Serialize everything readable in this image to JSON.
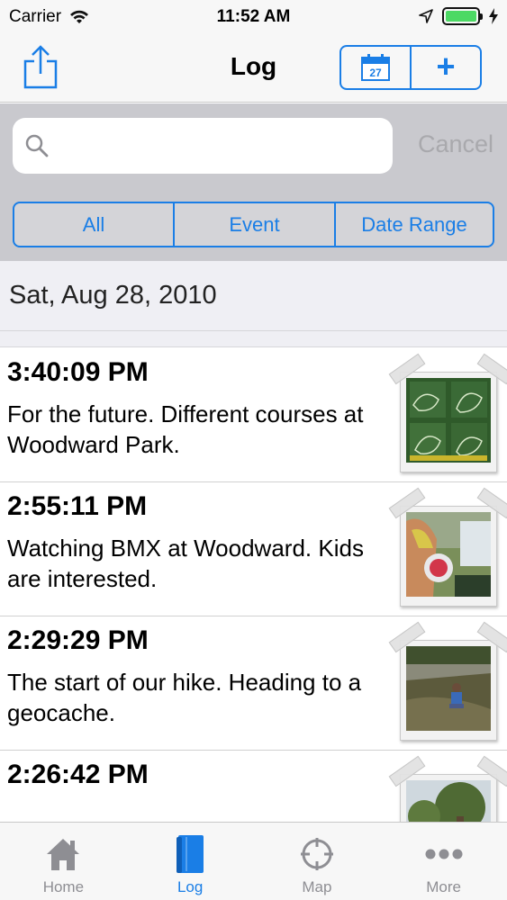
{
  "status_bar": {
    "carrier": "Carrier",
    "time": "11:52 AM",
    "battery_level": 1.0
  },
  "nav": {
    "title": "Log",
    "share_icon": "share-icon",
    "calendar_day": "27",
    "add_label": "+"
  },
  "search": {
    "placeholder": "",
    "cancel_label": "Cancel"
  },
  "filters": [
    {
      "label": "All"
    },
    {
      "label": "Event"
    },
    {
      "label": "Date Range"
    }
  ],
  "section": {
    "date": "Sat, Aug 28, 2010"
  },
  "log_entries": [
    {
      "time": "3:40:09 PM",
      "text": "For the future. Different courses at Woodward Park.",
      "thumbnail": "park-map-photo"
    },
    {
      "time": "2:55:11 PM",
      "text": "Watching BMX at Woodward. Kids are interested.",
      "thumbnail": "bmx-kid-photo"
    },
    {
      "time": "2:29:29 PM",
      "text": "The start of our hike. Heading to a geocache.",
      "thumbnail": "hike-photo"
    },
    {
      "time": "2:26:42 PM",
      "text": "",
      "thumbnail": "trees-photo"
    }
  ],
  "tab_bar": [
    {
      "label": "Home",
      "icon": "home-icon",
      "active": false
    },
    {
      "label": "Log",
      "icon": "book-icon",
      "active": true
    },
    {
      "label": "Map",
      "icon": "crosshair-icon",
      "active": false
    },
    {
      "label": "More",
      "icon": "more-icon",
      "active": false
    }
  ],
  "colors": {
    "accent": "#1a7ee6",
    "battery": "#4cd964",
    "tab_inactive": "#8e8e93"
  }
}
